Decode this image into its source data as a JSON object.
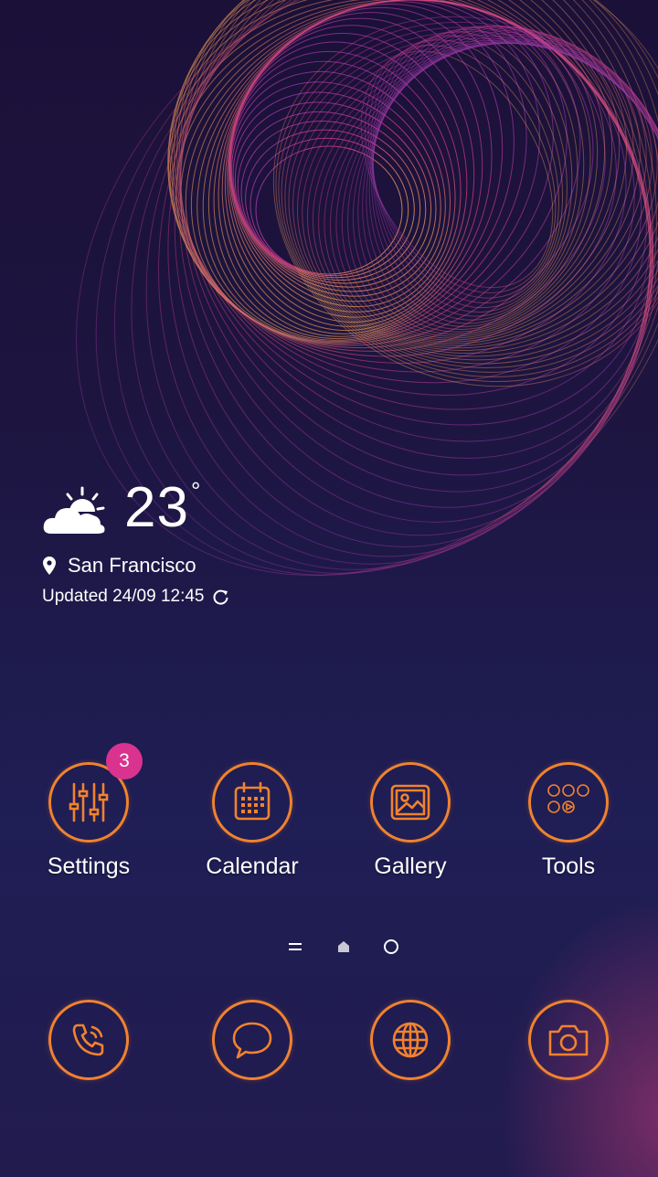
{
  "weather": {
    "temperature": "23",
    "unit": "°",
    "location": "San Francisco",
    "updated": "Updated 24/09 12:45",
    "condition_icon": "partly-sunny-icon"
  },
  "apps": [
    {
      "label": "Settings",
      "icon": "sliders-icon",
      "badge": "3"
    },
    {
      "label": "Calendar",
      "icon": "calendar-icon"
    },
    {
      "label": "Gallery",
      "icon": "image-icon"
    },
    {
      "label": "Tools",
      "icon": "folder-icons-group"
    }
  ],
  "page_indicators": [
    "menu-indicator",
    "home-indicator",
    "page-dot"
  ],
  "dock": [
    {
      "icon": "phone-icon"
    },
    {
      "icon": "message-icon"
    },
    {
      "icon": "globe-icon"
    },
    {
      "icon": "camera-icon"
    }
  ],
  "colors": {
    "accent": "#f0822f",
    "badge": "#d9338f",
    "wallpaper_pink": "#e0408a"
  }
}
